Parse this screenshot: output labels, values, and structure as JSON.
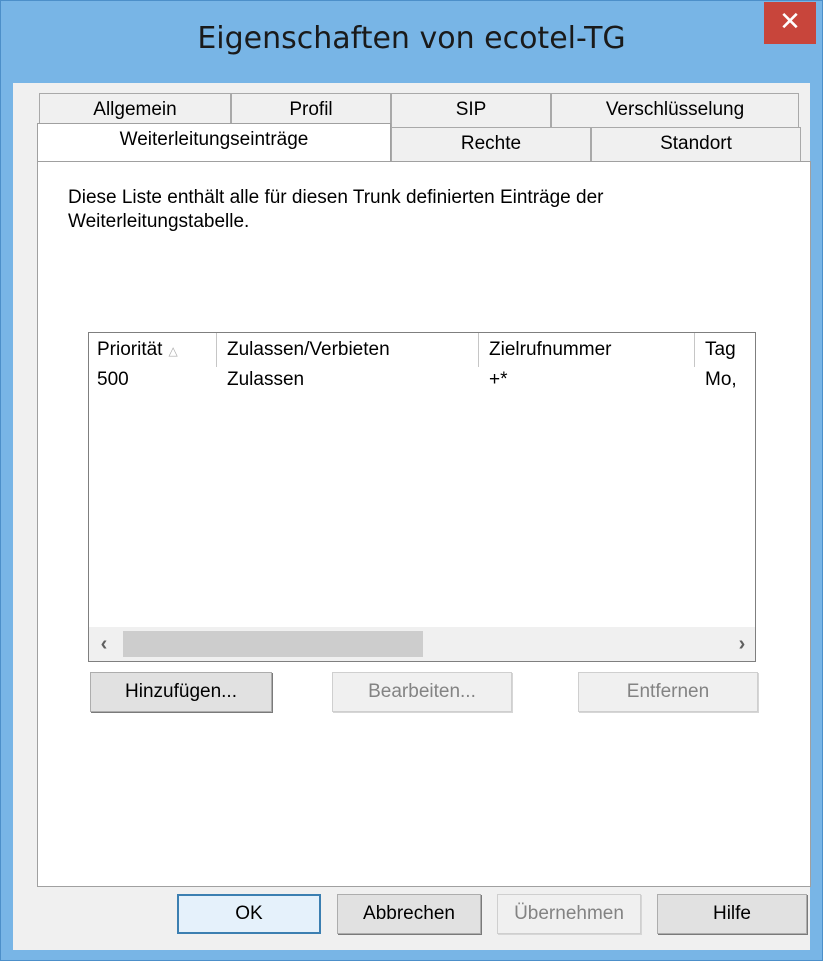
{
  "window": {
    "title": "Eigenschaften von ecotel-TG",
    "close_glyph": "✕"
  },
  "tabs": {
    "row_top": [
      "Allgemein",
      "Profil",
      "SIP",
      "Verschlüsselung"
    ],
    "row_bottom": [
      "Weiterleitungseinträge",
      "Rechte",
      "Standort"
    ],
    "active": "Weiterleitungseinträge"
  },
  "panel": {
    "description": "Diese Liste enthält alle für diesen Trunk definierten Einträge der Weiterleitungstabelle."
  },
  "list": {
    "columns": [
      "Priorität",
      "Zulassen/Verbieten",
      "Zielrufnummer",
      "Tag"
    ],
    "sort_indicator": "△",
    "rows": [
      [
        "500",
        "Zulassen",
        "+*",
        "Mo,"
      ]
    ],
    "scroll_left": "‹",
    "scroll_right": "›"
  },
  "panel_buttons": {
    "add": "Hinzufügen...",
    "edit": "Bearbeiten...",
    "remove": "Entfernen"
  },
  "dialog_buttons": {
    "ok": "OK",
    "cancel": "Abbrechen",
    "apply": "Übernehmen",
    "help": "Hilfe"
  },
  "colors": {
    "title_bar": "#78b5e6",
    "close_button": "#c8453b",
    "default_button_border": "#3c7fb1"
  },
  "icons": {
    "close": "close-icon",
    "sort": "sort-ascending-icon",
    "scroll_left": "chevron-left-icon",
    "scroll_right": "chevron-right-icon"
  }
}
